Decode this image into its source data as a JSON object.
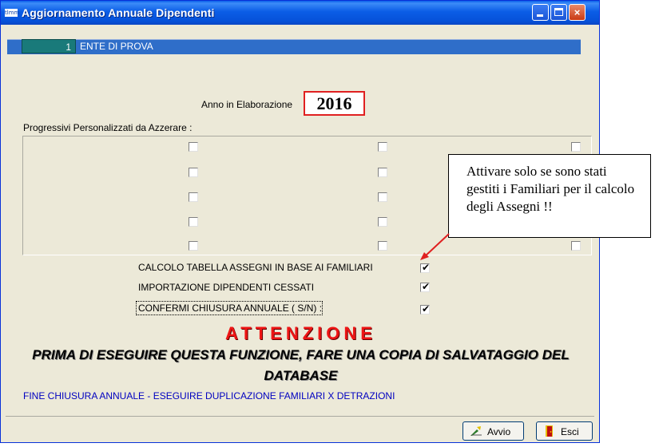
{
  "window": {
    "title": "Aggiornamento Annuale Dipendenti",
    "app_icon_text": "tlmm",
    "controls": {
      "minimize": "minimize",
      "maximize": "maximize",
      "close": "×"
    }
  },
  "ente": {
    "code": "1",
    "name": "ENTE DI PROVA"
  },
  "anno": {
    "label": "Anno in Elaborazione",
    "value": "2016"
  },
  "progressivi": {
    "label": "Progressivi Personalizzati  da Azzerare  :",
    "checkboxes": [
      [
        false,
        false,
        false
      ],
      [
        false,
        false,
        false
      ],
      [
        false,
        false,
        false
      ],
      [
        false,
        false,
        false
      ],
      [
        false,
        false,
        false
      ]
    ]
  },
  "callout": {
    "text": "Attivare solo se sono stati gestiti i Familiari per il calcolo degli Assegni !!",
    "line_color": "#E02020"
  },
  "options": [
    {
      "label": "CALCOLO TABELLA ASSEGNI IN BASE AI FAMILIARI",
      "checked": true
    },
    {
      "label": "IMPORTAZIONE DIPENDENTI CESSATI",
      "checked": true
    },
    {
      "label": "CONFERMI CHIUSURA ANNUALE ( S/N) :",
      "checked": true
    }
  ],
  "attenzione": "ATTENZIONE",
  "warning": "PRIMA DI ESEGUIRE QUESTA FUNZIONE, FARE UNA COPIA DI SALVATAGGIO DEL DATABASE",
  "status_text": "FINE CHIUSURA ANNUALE - ESEGUIRE DUPLICAZIONE FAMILIARI X DETRAZIONI",
  "buttons": {
    "avvio": "Avvio",
    "esci": "Esci"
  },
  "colors": {
    "title_bar": "#0A5FEA",
    "ente_bar": "#2F6EC9",
    "ente_code_bg": "#197A7A",
    "attenzione": "#EE1515",
    "status_text": "#0000C0"
  }
}
